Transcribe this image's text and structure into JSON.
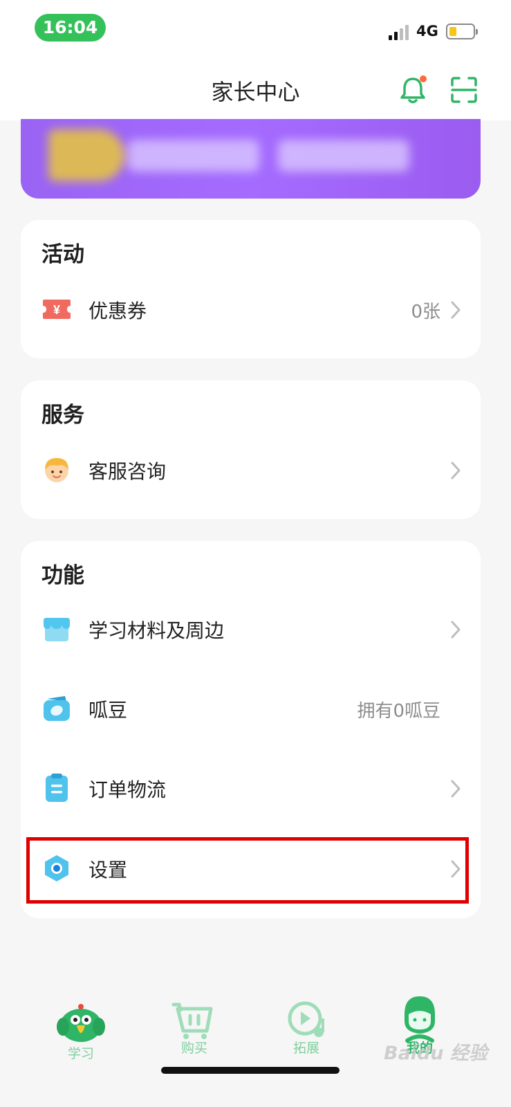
{
  "status_bar": {
    "time": "16:04",
    "network": "4G"
  },
  "header": {
    "title": "家长中心"
  },
  "sections": {
    "activity": {
      "title": "活动",
      "items": [
        {
          "label": "优惠券",
          "value": "0张",
          "icon": "coupon-icon"
        }
      ]
    },
    "service": {
      "title": "服务",
      "items": [
        {
          "label": "客服咨询",
          "value": "",
          "icon": "customer-service-avatar-icon"
        }
      ]
    },
    "function": {
      "title": "功能",
      "items": [
        {
          "label": "学习材料及周边",
          "value": "",
          "icon": "store-icon"
        },
        {
          "label": "呱豆",
          "value": "拥有0呱豆",
          "icon": "wallet-icon"
        },
        {
          "label": "订单物流",
          "value": "",
          "icon": "order-clipboard-icon"
        },
        {
          "label": "设置",
          "value": "",
          "icon": "settings-hexagon-icon"
        }
      ]
    }
  },
  "tabbar": {
    "tabs": [
      {
        "label": "学习",
        "icon": "parrot-mascot-icon"
      },
      {
        "label": "购买",
        "icon": "cart-icon"
      },
      {
        "label": "拓展",
        "icon": "play-music-icon"
      },
      {
        "label": "我的",
        "icon": "profile-icon"
      }
    ],
    "active_index": 3
  },
  "watermark": "Baidu 经验",
  "colors": {
    "accent_green": "#2fb566",
    "status_pill": "#35c159",
    "banner": "#a56bff",
    "highlight_border": "#e00000"
  }
}
